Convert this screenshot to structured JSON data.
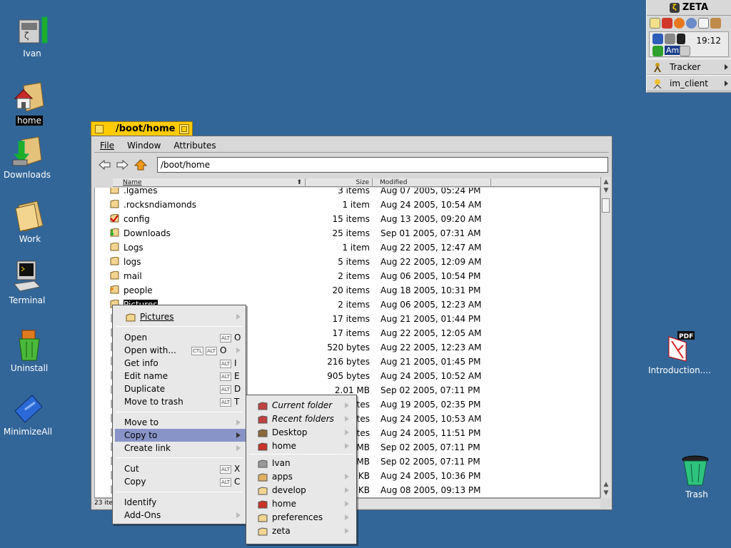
{
  "desktop": {
    "icons": [
      {
        "label": "Ivan",
        "name": "ivan"
      },
      {
        "label": "home",
        "name": "home"
      },
      {
        "label": "Downloads",
        "name": "downloads"
      },
      {
        "label": "Work",
        "name": "work"
      },
      {
        "label": "Terminal",
        "name": "terminal"
      },
      {
        "label": "Uninstall",
        "name": "uninstall"
      },
      {
        "label": "MinimizeAll",
        "name": "minimizeall"
      },
      {
        "label": "Introduction....",
        "name": "introduction"
      },
      {
        "label": "Trash",
        "name": "trash"
      }
    ]
  },
  "deskbar": {
    "brand": "ZETA",
    "clock": "19:12",
    "tray_badge": "Am",
    "apps": [
      {
        "label": "Tracker"
      },
      {
        "label": "im_client"
      }
    ]
  },
  "window": {
    "title": "/boot/home",
    "menus": [
      "File",
      "Window",
      "Attributes"
    ],
    "path": "/boot/home",
    "columns": {
      "name": "Name",
      "size": "Size",
      "modified": "Modified"
    },
    "status": "23 ite",
    "rows": [
      {
        "name": ".lgames",
        "size": "3 items",
        "modified": "Aug 07 2005, 05:24 PM"
      },
      {
        "name": ".rocksndiamonds",
        "size": "1 item",
        "modified": "Aug 24 2005, 10:54 AM"
      },
      {
        "name": "config",
        "size": "15 items",
        "modified": "Aug 13 2005, 09:20 AM"
      },
      {
        "name": "Downloads",
        "size": "25 items",
        "modified": "Sep 01 2005, 07:31 AM"
      },
      {
        "name": "Logs",
        "size": "1 item",
        "modified": "Aug 22 2005, 12:47 AM"
      },
      {
        "name": "logs",
        "size": "5 items",
        "modified": "Aug 22 2005, 12:09 AM"
      },
      {
        "name": "mail",
        "size": "2 items",
        "modified": "Aug 06 2005, 10:54 PM"
      },
      {
        "name": "people",
        "size": "20 items",
        "modified": "Aug 18 2005, 10:31 PM"
      },
      {
        "name": "Pictures",
        "size": "2 items",
        "modified": "Aug 06 2005, 12:23 AM"
      },
      {
        "name": "",
        "size": "17 items",
        "modified": "Aug 21 2005, 01:44 PM"
      },
      {
        "name": "",
        "size": "17 items",
        "modified": "Aug 22 2005, 12:05 AM"
      },
      {
        "name": "",
        "size": "520 bytes",
        "modified": "Aug 22 2005, 12:23 AM"
      },
      {
        "name": "",
        "size": "216 bytes",
        "modified": "Aug 21 2005, 01:45 PM"
      },
      {
        "name": "",
        "size": "905 bytes",
        "modified": "Aug 24 2005, 10:52 AM"
      },
      {
        "name": "",
        "size": "2.01 MB",
        "modified": "Sep 02 2005, 07:11 PM"
      },
      {
        "name": "",
        "size": "ytes",
        "modified": "Aug 19 2005, 02:35 PM"
      },
      {
        "name": "",
        "size": "ytes",
        "modified": "Aug 24 2005, 10:53 AM"
      },
      {
        "name": "",
        "size": "ytes",
        "modified": "Aug 24 2005, 11:51 PM"
      },
      {
        "name": "",
        "size": "MB",
        "modified": "Sep 02 2005, 07:11 PM"
      },
      {
        "name": "",
        "size": "MB",
        "modified": "Sep 02 2005, 07:11 PM"
      },
      {
        "name": "",
        "size": "KB",
        "modified": "Aug 24 2005, 10:36 PM"
      },
      {
        "name": "",
        "size": "KB",
        "modified": "Aug 08 2005, 09:13 PM"
      }
    ]
  },
  "context_menu": {
    "header": "Pictures",
    "items": {
      "open": {
        "label": "Open",
        "mod": "ALT",
        "key": "O"
      },
      "open_with": {
        "label": "Open with...",
        "mod1": "CTL",
        "mod2": "ALT",
        "key": "O"
      },
      "get_info": {
        "label": "Get info",
        "mod": "ALT",
        "key": "I"
      },
      "edit_name": {
        "label": "Edit name",
        "mod": "ALT",
        "key": "E"
      },
      "duplicate": {
        "label": "Duplicate",
        "mod": "ALT",
        "key": "D"
      },
      "move_to_trash": {
        "label": "Move to trash",
        "mod": "ALT",
        "key": "T"
      },
      "move_to": {
        "label": "Move to"
      },
      "copy_to": {
        "label": "Copy to"
      },
      "create_link": {
        "label": "Create link"
      },
      "cut": {
        "label": "Cut",
        "mod": "ALT",
        "key": "X"
      },
      "copy": {
        "label": "Copy",
        "mod": "ALT",
        "key": "C"
      },
      "identify": {
        "label": "Identify"
      },
      "add_ons": {
        "label": "Add-Ons"
      }
    }
  },
  "copy_submenu": {
    "items": [
      {
        "label": "Current folder",
        "italic": true
      },
      {
        "label": "Recent folders",
        "italic": true
      },
      {
        "label": "Desktop"
      },
      {
        "label": "home"
      },
      {
        "label": "Ivan"
      },
      {
        "label": "apps"
      },
      {
        "label": "develop"
      },
      {
        "label": "home"
      },
      {
        "label": "preferences"
      },
      {
        "label": "zeta"
      }
    ]
  },
  "colors": {
    "desktop": "#336698",
    "window_tab": "#ffcb00",
    "menu_selection": "#8893c8"
  }
}
